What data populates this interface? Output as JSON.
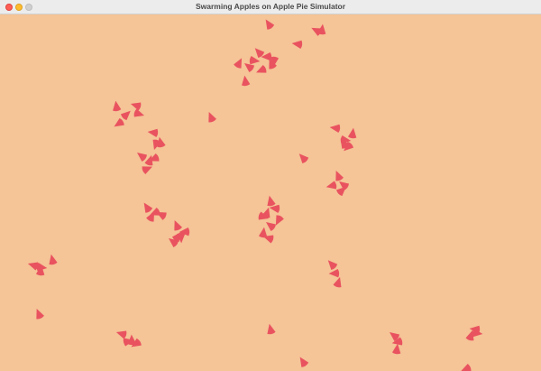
{
  "window": {
    "title": "Swarming Apples on Apple Pie Simulator",
    "controls": [
      "close-button",
      "minimize-button",
      "zoom-button"
    ]
  },
  "simulation": {
    "background_color": "#f5c497",
    "slice_color": "#e9535f",
    "agent_icon": "apple-slice-icon"
  }
}
